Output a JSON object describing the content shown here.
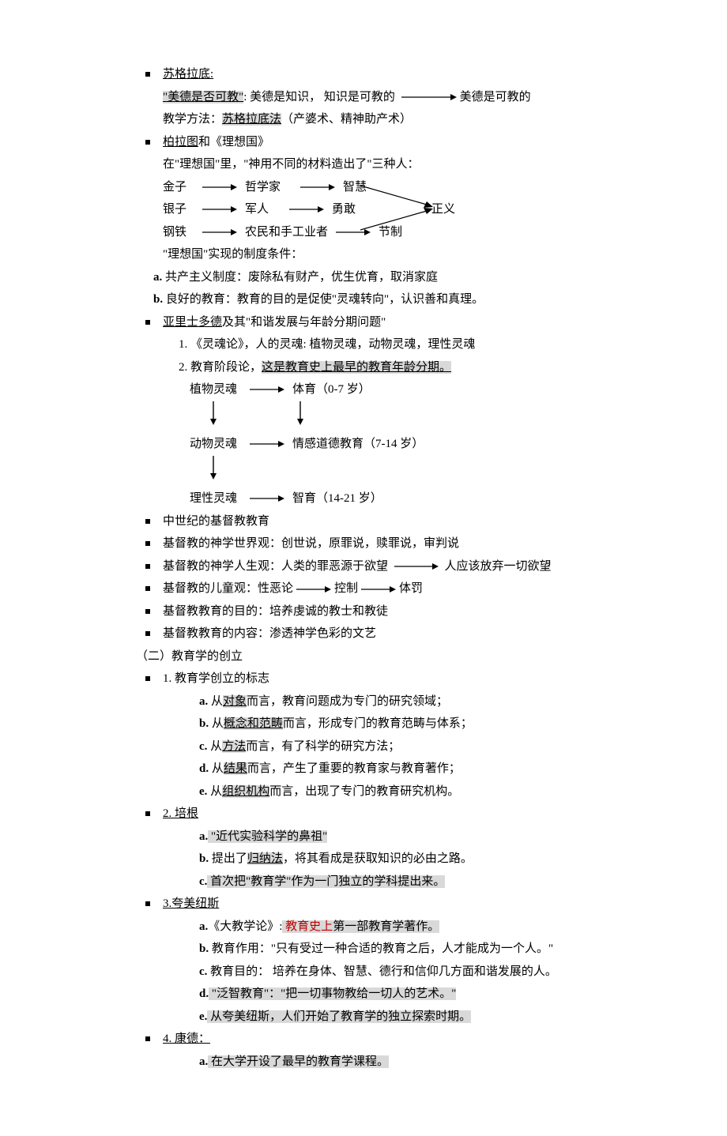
{
  "socrates": {
    "name": "苏格拉底:",
    "q": "\"美德是否可教\"",
    "l1a": ": 美德是知识，  知识是可教的",
    "l1b": "美德是可教的",
    "l2a": "教学方法：",
    "l2b": "苏格拉底法",
    "l2c": "（产婆术、精神助产术）"
  },
  "plato": {
    "name": "柏拉图",
    "and": "和《理想国》",
    "intro": "在\"理想国\"里，\"神用不同的材料造出了\"三种人：",
    "r1a": "金子",
    "r1b": "哲学家",
    "r1c": "智慧",
    "r2a": "银子",
    "r2b": "军人",
    "r2c": "勇敢",
    "r3a": "钢铁",
    "r3b": "农民和手工业者",
    "r3c": "节制",
    "justice": "正义",
    "cond": "\"理想国\"实现的制度条件：",
    "a_lbl": "a.",
    "a": " 共产主义制度：废除私有财产，优生优育，取消家庭",
    "b_lbl": "b.",
    "b": " 良好的教育：教育的目的是促使\"灵魂转向\"，认识善和真理。"
  },
  "aristotle": {
    "name": "亚里士多德",
    "rest": "及其\"和谐发展与年龄分期问题\"",
    "s1": "1. 《灵魂论》，人的灵魂: 植物灵魂，动物灵魂，理性灵魂",
    "s2a": "2. 教育阶段论，",
    "s2b": "这是教育史上最早的教育年龄分期。",
    "r1a": "植物灵魂",
    "r1b": "体育（0-7 岁）",
    "r2a": "动物灵魂",
    "r2b": "情感道德教育（7-14 岁）",
    "r3a": "理性灵魂",
    "r3b": "智育（14-21 岁）"
  },
  "christ": {
    "t1": "中世纪的基督教教育",
    "t2a": "基督教的神学世界观：创世说，原罪说，赎罪说，审判说",
    "t3a": "基督教的神学人生观：人类的罪恶源于欲望",
    "t3b": "人应该放弃一切欲望",
    "t4a": "基督教的儿童观：性恶论",
    "t4b": "控制",
    "t4c": "体罚",
    "t5": "基督教教育的目的：培养虔诚的教士和教徒",
    "t6": "基督教教育的内容：渗透神学色彩的文艺"
  },
  "section2": "（二）教育学的创立",
  "founding": {
    "t": "1. 教育学创立的标志",
    "a_lbl": "a.",
    "a1": " 从",
    "a2": "对象",
    "a3": "而言，教育问题成为专门的研究领域；",
    "b_lbl": "b.",
    "b1": " 从",
    "b2": "概念和范畴",
    "b3": "而言，形成专门的教育范畴与体系；",
    "c_lbl": "c.",
    "c1": " 从",
    "c2": "方法",
    "c3": "而言，有了科学的研究方法；",
    "d_lbl": "d.",
    "d1": " 从",
    "d2": "结果",
    "d3": "而言，产生了重要的教育家与教育著作；",
    "e_lbl": "e.",
    "e1": " 从",
    "e2": "组织机构",
    "e3": "而言，出现了专门的教育研究机构。"
  },
  "bacon": {
    "t": "2. 培根",
    "a_lbl": "a.",
    "a": " \"近代实验科学的鼻祖\"",
    "b_lbl": "b.",
    "b1": " 提出了",
    "b2": "归纳法",
    "b3": "，将其看成是获取知识的必由之路。",
    "c_lbl": "c.",
    "c": " 首次把\"教育学\"作为一门独立的学科提出来。"
  },
  "comenius": {
    "t": "3.夸美纽斯",
    "a_lbl": "a.",
    "a1": "《大教学论》:",
    "a2": " 教育史上",
    "a3": "第一部教育学著作。",
    "b_lbl": "b.",
    "b": " 教育作用：\"只有受过一种合适的教育之后，人才能成为一个人。\"",
    "c_lbl": "c.",
    "c": " 教育目的：  培养在身体、智慧、德行和信仰几方面和谐发展的人。",
    "d_lbl": "d.",
    "d": " \"泛智教育\"：\"把一切事物教给一切人的艺术。\"",
    "e_lbl": "e.",
    "e": " 从夸美纽斯，人们开始了教育学的独立探索时期。"
  },
  "kant": {
    "t": "4. 康德：",
    "a_lbl": "a.",
    "a": " 在大学开设了最早的教育学课程。"
  }
}
